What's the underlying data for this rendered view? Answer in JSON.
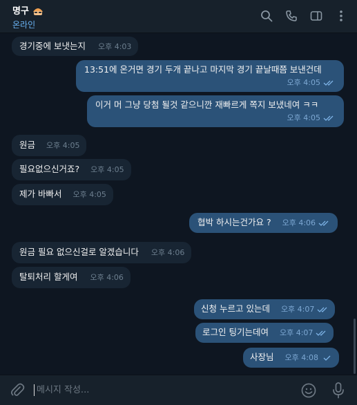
{
  "header": {
    "title": "명구",
    "status": "온라인"
  },
  "messages": [
    {
      "text": "경기중에 보냇는지",
      "time": "오후 4:03",
      "dir": "in"
    },
    {
      "text": "13:51에 온거면 경기 두개 끝나고 마지막 경기 끝날때쯤 보낸건데",
      "time": "오후 4:05",
      "dir": "out",
      "read": true
    },
    {
      "text": "이거 머 그냥 당첨 될것 같으니깐 재빠르게 쪽지 보냈네여 ㅋㅋ",
      "time": "오후 4:05",
      "dir": "out",
      "read": true
    },
    {
      "text": "원금",
      "time": "오후 4:05",
      "dir": "in"
    },
    {
      "text": "필요없으신거죠?",
      "time": "오후 4:05",
      "dir": "in"
    },
    {
      "text": "제가 바빠서",
      "time": "오후 4:05",
      "dir": "in"
    },
    {
      "text": "협박 하시는건가요 ?",
      "time": "오후 4:06",
      "dir": "out",
      "read": true
    },
    {
      "text": "원금 필요 없으신걸로 알겠습니다",
      "time": "오후 4:06",
      "dir": "in"
    },
    {
      "text": "탈퇴처리 할게여",
      "time": "오후 4:06",
      "dir": "in"
    },
    {
      "text": "신청 누르고 있는데",
      "time": "오후 4:07",
      "dir": "out",
      "read": true
    },
    {
      "text": "로그인 팅기는데여",
      "time": "오후 4:07",
      "dir": "out",
      "read": true
    },
    {
      "text": "사장님",
      "time": "오후 4:08",
      "dir": "out",
      "read": false
    }
  ],
  "composer": {
    "placeholder": "메시지 작성..."
  },
  "icons": {
    "search": "search-icon",
    "call": "phone-icon",
    "sidebar": "sidebar-toggle-icon",
    "more": "more-vertical-icon",
    "attach": "paperclip-icon",
    "emoji": "emoji-icon",
    "mic": "microphone-icon"
  },
  "colors": {
    "background": "#0e1621",
    "header": "#17212b",
    "incoming_bubble": "#182533",
    "outgoing_bubble": "#2b5278",
    "accent": "#6ab3f3"
  }
}
